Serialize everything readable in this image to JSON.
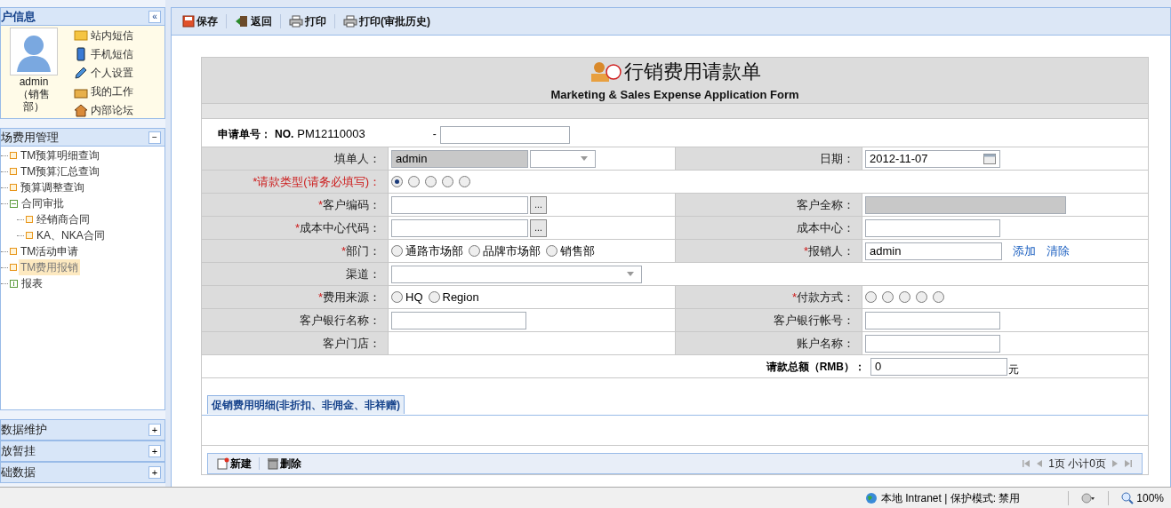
{
  "sidebar": {
    "user_panel": {
      "title": "户信息",
      "collapse": "«",
      "user_name": "admin",
      "user_dept": "（销售部）",
      "links": [
        {
          "label": "站内短信"
        },
        {
          "label": "手机短信"
        },
        {
          "label": "个人设置"
        },
        {
          "label": "我的工作"
        },
        {
          "label": "内部论坛"
        }
      ]
    },
    "menu_panel": {
      "title": "场费用管理",
      "toggle": "−",
      "items": [
        {
          "label": "TM预算明细查询",
          "selected": false
        },
        {
          "label": "TM预算汇总查询",
          "selected": false
        },
        {
          "label": "预算调整查询",
          "selected": false
        },
        {
          "label": "合同审批",
          "selected": false,
          "expanded": true,
          "children": [
            {
              "label": "经销商合同",
              "selected": false
            },
            {
              "label": "KA、NKA合同",
              "selected": false
            }
          ]
        },
        {
          "label": "TM活动申请",
          "selected": false
        },
        {
          "label": "TM费用报销",
          "selected": true
        },
        {
          "label": "报表",
          "selected": false,
          "expanded": false
        }
      ]
    },
    "collapsed_panels": [
      {
        "title": "数据维护",
        "toggle": "+"
      },
      {
        "title": "放暂挂",
        "toggle": "+"
      },
      {
        "title": "础数据",
        "toggle": "+"
      }
    ]
  },
  "toolbar": [
    {
      "label": "保存"
    },
    {
      "label": "返回"
    },
    {
      "label": "打印"
    },
    {
      "label": "打印(审批历史)"
    }
  ],
  "form": {
    "title": "行销费用请款单",
    "subtitle": "Marketing & Sales Expense Application Form",
    "number_label": "申请单号：",
    "number_prefix": "NO.",
    "number": "PM12110003",
    "number_dash": "-",
    "rows": [
      {
        "fields": [
          {
            "label": "填单人：",
            "kind": "input_select",
            "value": "admin",
            "disabled": true
          },
          {
            "label": "日期：",
            "kind": "date",
            "value": "2012-11-07"
          }
        ]
      },
      {
        "fields": [
          {
            "mark": "*",
            "label": "请款类型(请务必填写)：",
            "highlight": true,
            "kind": "radios",
            "options": [
              {
                "selected": true
              },
              {
                "selected": false
              },
              {
                "selected": false
              },
              {
                "selected": false
              },
              {
                "selected": false
              }
            ]
          }
        ]
      },
      {
        "fields": [
          {
            "mark": "*",
            "label": "客户编码：",
            "kind": "lookup",
            "button": "..."
          },
          {
            "label": "客户全称：",
            "kind": "input",
            "disabled": true
          }
        ]
      },
      {
        "fields": [
          {
            "mark": "*",
            "label": "成本中心代码：",
            "kind": "lookup",
            "button": "..."
          },
          {
            "label": "成本中心：",
            "kind": "input",
            "disabled": false
          }
        ]
      },
      {
        "fields": [
          {
            "mark": "*",
            "label": "部门：",
            "kind": "radios",
            "options": [
              {
                "label": "通路市场部",
                "selected": false
              },
              {
                "label": "品牌市场部",
                "selected": false
              },
              {
                "label": "销售部",
                "selected": false
              }
            ]
          },
          {
            "mark": "*",
            "label": "报销人：",
            "kind": "input_links",
            "value": "admin",
            "links": [
              "添加",
              "清除"
            ]
          }
        ]
      },
      {
        "fields": [
          {
            "label": "渠道：",
            "kind": "select"
          }
        ]
      },
      {
        "fields": [
          {
            "mark": "*",
            "label": "费用来源：",
            "kind": "radios",
            "options": [
              {
                "label": "HQ",
                "selected": false
              },
              {
                "label": "Region",
                "selected": false
              }
            ]
          },
          {
            "mark": "*",
            "label": "付款方式：",
            "kind": "radios",
            "options": [
              {
                "selected": false
              },
              {
                "selected": false
              },
              {
                "selected": false
              },
              {
                "selected": false
              },
              {
                "selected": false
              }
            ]
          }
        ]
      },
      {
        "fields": [
          {
            "label": "客户银行名称：",
            "kind": "input",
            "disabled": false
          },
          {
            "label": "客户银行帐号：",
            "kind": "input",
            "disabled": false
          }
        ]
      },
      {
        "fields": [
          {
            "label": "客户门店：",
            "kind": "empty"
          },
          {
            "label": "账户名称：",
            "kind": "input",
            "disabled": false
          }
        ]
      }
    ],
    "total": {
      "label": "请款总额（RMB）：",
      "value": "0",
      "unit": "元"
    }
  },
  "detail": {
    "tab": "促销费用明细(非折扣、非佣金、非祥赠)",
    "actions": [
      {
        "label": "新建"
      },
      {
        "label": "删除"
      }
    ],
    "pager": "1页 小计0页"
  },
  "status_bar": {
    "zone": "本地 Intranet | 保护模式: 禁用",
    "zoom": "100%"
  }
}
